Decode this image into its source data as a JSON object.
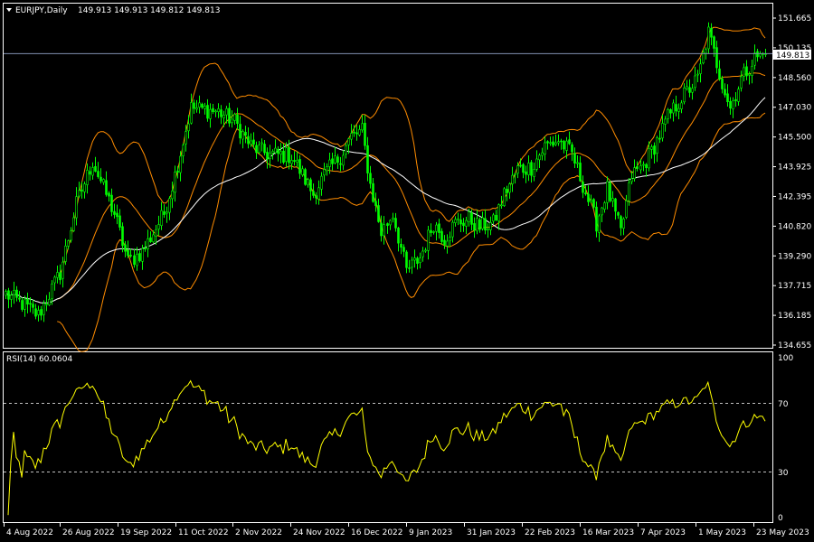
{
  "header": {
    "symbol_label": "EURJPY,Daily",
    "ohlc_text": "149.913 149.913 149.812 149.813"
  },
  "current_price_label": "149.813",
  "rsi_header": "RSI(14) 60.0604",
  "colors": {
    "background": "#000000",
    "frame": "#ffffff",
    "bull": "#00ff00",
    "bear": "#00ff00",
    "bollinger": "#ff8c00",
    "ma": "#ffffff",
    "rsi": "#ffff00",
    "levels": "#c0c0c0",
    "price_line": "#8090b0"
  },
  "chart_data": [
    {
      "type": "candlestick",
      "title": "EURJPY,Daily",
      "y_ticks": [
        "151.665",
        "150.135",
        "148.560",
        "147.030",
        "145.500",
        "143.925",
        "142.395",
        "140.820",
        "139.290",
        "137.715",
        "136.185",
        "134.655"
      ],
      "x_ticks": [
        "4 Aug 2022",
        "26 Aug 2022",
        "19 Sep 2022",
        "11 Oct 2022",
        "2 Nov 2022",
        "24 Nov 2022",
        "16 Dec 2022",
        "9 Jan 2023",
        "31 Jan 2023",
        "22 Feb 2023",
        "16 Mar 2023",
        "7 Apr 2023",
        "1 May 2023",
        "23 May 2023"
      ],
      "ylim": [
        134.655,
        151.665
      ],
      "current_price": 149.813,
      "close_anchors": [
        [
          0,
          137.3
        ],
        [
          6,
          136.8
        ],
        [
          12,
          136.2
        ],
        [
          20,
          138.4
        ],
        [
          26,
          142.0
        ],
        [
          32,
          144.2
        ],
        [
          40,
          141.5
        ],
        [
          45,
          139.0
        ],
        [
          50,
          139.5
        ],
        [
          58,
          141.5
        ],
        [
          62,
          143.5
        ],
        [
          68,
          147.0
        ],
        [
          78,
          146.8
        ],
        [
          84,
          146.3
        ],
        [
          90,
          145.0
        ],
        [
          96,
          144.6
        ],
        [
          105,
          144.5
        ],
        [
          113,
          142.5
        ],
        [
          117,
          143.5
        ],
        [
          123,
          144.5
        ],
        [
          127,
          145.5
        ],
        [
          131,
          145.8
        ],
        [
          134,
          143.0
        ],
        [
          138,
          140.5
        ],
        [
          142,
          141.5
        ],
        [
          147,
          138.5
        ],
        [
          152,
          139.2
        ],
        [
          157,
          141.0
        ],
        [
          161,
          140.2
        ],
        [
          165,
          141.0
        ],
        [
          170,
          141.2
        ],
        [
          174,
          140.8
        ],
        [
          179,
          141.0
        ],
        [
          183,
          142.5
        ],
        [
          188,
          143.8
        ],
        [
          193,
          143.9
        ],
        [
          198,
          145.0
        ],
        [
          203,
          145.3
        ],
        [
          208,
          144.6
        ],
        [
          212,
          143.0
        ],
        [
          217,
          141.0
        ],
        [
          221,
          142.8
        ],
        [
          226,
          140.5
        ],
        [
          230,
          143.5
        ],
        [
          234,
          144.0
        ],
        [
          238,
          145.0
        ],
        [
          243,
          146.5
        ],
        [
          248,
          147.5
        ],
        [
          254,
          148.5
        ],
        [
          258,
          150.9
        ],
        [
          262,
          148.8
        ],
        [
          266,
          147.0
        ],
        [
          270,
          148.5
        ],
        [
          275,
          149.6
        ],
        [
          279,
          149.8
        ]
      ],
      "bollinger": {
        "period": 20,
        "deviations": 2
      },
      "moving_average": {
        "period": 50
      },
      "series_count": 280
    },
    {
      "type": "line",
      "title": "RSI(14) 60.0604",
      "ylim": [
        0,
        100
      ],
      "y_ticks": [
        "100",
        "70",
        "30",
        "0"
      ],
      "levels": [
        70,
        30
      ],
      "last_value": 60.0604
    }
  ]
}
